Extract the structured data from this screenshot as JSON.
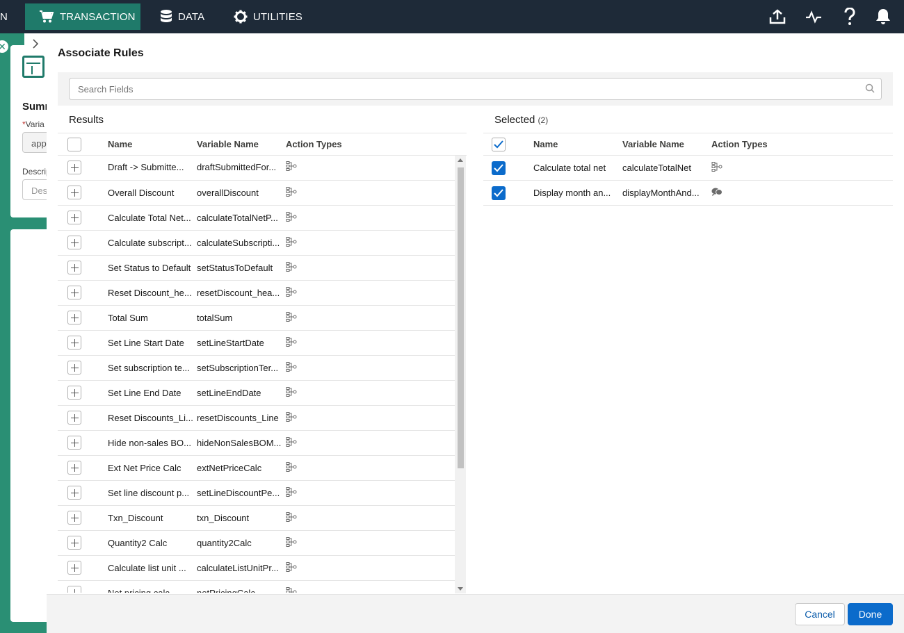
{
  "nav": {
    "truncated_label": "N",
    "items": [
      {
        "label": "TRANSACTION",
        "icon": "cart-icon"
      },
      {
        "label": "DATA",
        "icon": "database-icon"
      },
      {
        "label": "UTILITIES",
        "icon": "gear-icon"
      }
    ],
    "right_icons": [
      "upload-icon",
      "activity-icon",
      "help-icon",
      "bell-icon"
    ]
  },
  "background_page": {
    "title_partial": "Summ",
    "variable_label_partial": "Varia",
    "variable_value_partial": "app",
    "description_label_partial": "Descrip",
    "description_placeholder_partial": "Des"
  },
  "panel": {
    "title": "Associate Rules",
    "search_placeholder": "Search Fields"
  },
  "results": {
    "title": "Results",
    "columns": {
      "name": "Name",
      "variable": "Variable Name",
      "action": "Action Types"
    },
    "rows": [
      {
        "name": "Draft -> Submitte...",
        "variable": "draftSubmittedFor...",
        "action_icon": "rule-tree-icon"
      },
      {
        "name": "Overall Discount",
        "variable": "overallDiscount",
        "action_icon": "rule-tree-icon"
      },
      {
        "name": "Calculate Total Net...",
        "variable": "calculateTotalNetP...",
        "action_icon": "rule-tree-icon"
      },
      {
        "name": "Calculate subscript...",
        "variable": "calculateSubscripti...",
        "action_icon": "rule-tree-icon"
      },
      {
        "name": "Set Status to Default",
        "variable": "setStatusToDefault",
        "action_icon": "rule-tree-icon"
      },
      {
        "name": "Reset Discount_he...",
        "variable": "resetDiscount_hea...",
        "action_icon": "rule-tree-icon"
      },
      {
        "name": "Total Sum",
        "variable": "totalSum",
        "action_icon": "rule-tree-icon"
      },
      {
        "name": "Set Line Start Date",
        "variable": "setLineStartDate",
        "action_icon": "rule-tree-icon"
      },
      {
        "name": "Set subscription te...",
        "variable": "setSubscriptionTer...",
        "action_icon": "rule-tree-icon"
      },
      {
        "name": "Set Line End Date",
        "variable": "setLineEndDate",
        "action_icon": "rule-tree-icon"
      },
      {
        "name": "Reset Discounts_Li...",
        "variable": "resetDiscounts_Line",
        "action_icon": "rule-tree-icon"
      },
      {
        "name": "Hide non-sales BO...",
        "variable": "hideNonSalesBOM...",
        "action_icon": "rule-tree-icon"
      },
      {
        "name": "Ext Net Price Calc",
        "variable": "extNetPriceCalc",
        "action_icon": "rule-tree-icon"
      },
      {
        "name": "Set line discount p...",
        "variable": "setLineDiscountPe...",
        "action_icon": "rule-tree-icon"
      },
      {
        "name": "Txn_Discount",
        "variable": "txn_Discount",
        "action_icon": "rule-tree-icon"
      },
      {
        "name": "Quantity2 Calc",
        "variable": "quantity2Calc",
        "action_icon": "rule-tree-icon"
      },
      {
        "name": "Calculate list unit ...",
        "variable": "calculateListUnitPr...",
        "action_icon": "rule-tree-icon"
      },
      {
        "name": "Net pricing calc",
        "variable": "netPricingCalc",
        "action_icon": "rule-tree-icon"
      }
    ]
  },
  "selected": {
    "title": "Selected",
    "count": "(2)",
    "columns": {
      "name": "Name",
      "variable": "Variable Name",
      "action": "Action Types"
    },
    "rows": [
      {
        "name": "Calculate total net",
        "variable": "calculateTotalNet",
        "action_icon": "rule-tree-icon"
      },
      {
        "name": "Display month an...",
        "variable": "displayMonthAnd...",
        "action_icon": "chat-bubbles-icon"
      }
    ]
  },
  "footer": {
    "cancel_label": "Cancel",
    "done_label": "Done"
  },
  "colors": {
    "nav_bg": "#1e2a38",
    "nav_active": "#1f7a6a",
    "brand_green": "#2a8f74",
    "primary_blue": "#0b6bcb"
  }
}
